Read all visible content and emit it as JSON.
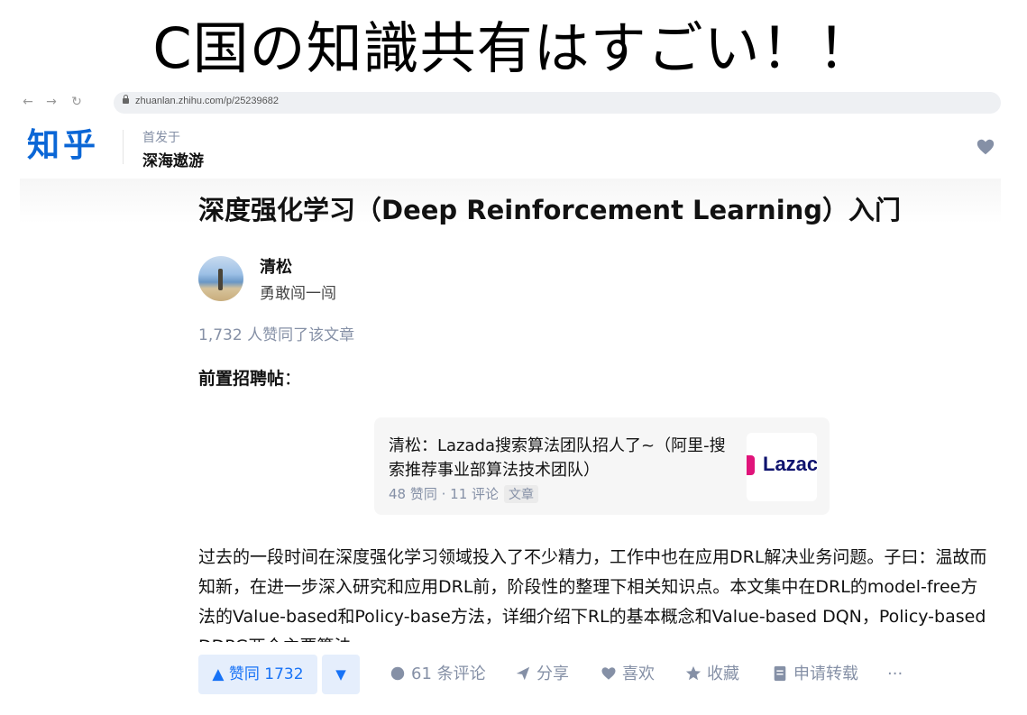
{
  "headline": "C国の知識共有はすごい！！",
  "browser": {
    "back": "←",
    "forward": "→",
    "reload": "↻",
    "url": "zhuanlan.zhihu.com/p/25239682"
  },
  "header": {
    "logo": "知乎",
    "first_published_label": "首发于",
    "column_name": "深海遨游"
  },
  "article": {
    "title": "深度强化学习（Deep Reinforcement Learning）入门",
    "author_name": "清松",
    "author_bio": "勇敢闯一闯",
    "vote_summary": "1,732 人赞同了该文章",
    "pre_label_bold": "前置招聘帖",
    "pre_label_colon": "：",
    "card": {
      "title": "清松：Lazada搜索算法团队招人了~（阿里-搜索推荐事业部算法技术团队）",
      "meta": "48 赞同 · 11 评论",
      "tag": "文章",
      "thumb_text": "Lazac"
    },
    "paragraph": "过去的一段时间在深度强化学习领域投入了不少精力，工作中也在应用DRL解决业务问题。子曰：温故而知新，在进一步深入研究和应用DRL前，阶段性的整理下相关知识点。本文集中在DRL的model-free方法的Value-based和Policy-base方法，详细介绍下RL的基本概念和Value-based DQN，Policy-based DDPG两个主要算法"
  },
  "actions": {
    "vote_up": "▲ 赞同 1732",
    "vote_down": "▼",
    "comments": "61 条评论",
    "share": "分享",
    "like": "喜欢",
    "favorite": "收藏",
    "repost": "申请转载",
    "more": "···"
  },
  "colors": {
    "brand": "#0a66d6",
    "vote_bg": "#e5eefc",
    "vote_text": "#1772f6",
    "muted": "#8590a6"
  }
}
